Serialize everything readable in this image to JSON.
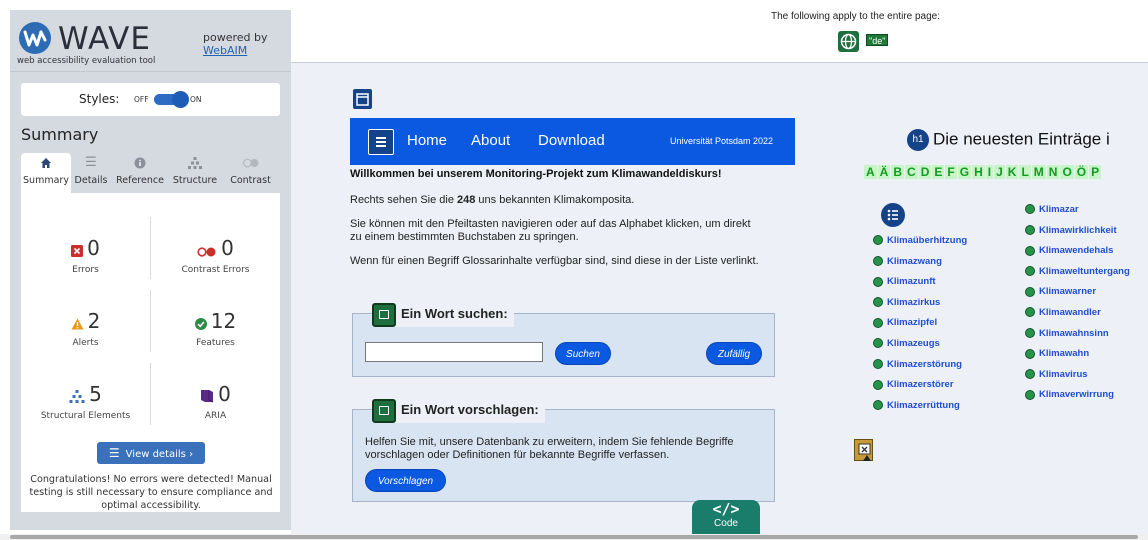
{
  "wave": {
    "logo_text": "WAVE",
    "tagline": "web accessibility evaluation tool",
    "powered_by": "powered by",
    "webaim_link": "WebAIM",
    "styles_label": "Styles:",
    "styles_off": "OFF",
    "styles_on": "ON",
    "summary_heading": "Summary",
    "tabs": [
      {
        "label": "Summary",
        "icon": "home-icon",
        "active": true
      },
      {
        "label": "Details",
        "icon": "list-icon",
        "active": false
      },
      {
        "label": "Reference",
        "icon": "info-icon",
        "active": false
      },
      {
        "label": "Structure",
        "icon": "hierarchy-icon",
        "active": false
      },
      {
        "label": "Contrast",
        "icon": "contrast-icon",
        "active": false
      }
    ],
    "stats": {
      "errors": {
        "value": "0",
        "label": "Errors"
      },
      "contrast_errors": {
        "value": "0",
        "label": "Contrast Errors"
      },
      "alerts": {
        "value": "2",
        "label": "Alerts"
      },
      "features": {
        "value": "12",
        "label": "Features"
      },
      "structural": {
        "value": "5",
        "label": "Structural Elements"
      },
      "aria": {
        "value": "0",
        "label": "ARIA"
      }
    },
    "view_details": "View details ›",
    "congrats": "Congratulations! No errors were detected! Manual testing is still necessary to ensure compliance and optimal accessibility."
  },
  "page_top": {
    "notice": "The following apply to the entire page:",
    "lang_badge": "\"de\""
  },
  "site": {
    "nav": {
      "home": "Home",
      "about": "About",
      "download": "Download",
      "university": "Universität Potsdam 2022"
    },
    "intro_title": "Willkommen bei unserem Monitoring-Projekt zum Klimawandeldiskurs!",
    "intro_p1_prefix": "Rechts sehen Sie die ",
    "intro_p1_count": "248",
    "intro_p1_suffix": " uns bekannten Klimakomposita.",
    "intro_p2": "Sie können mit den Pfeiltasten navigieren oder auf das Alphabet klicken, um direkt zu einem bestimmten Buchstaben zu springen.",
    "intro_p3": "Wenn für einen Begriff Glossarinhalte verfügbar sind, sind diese in der Liste verlinkt.",
    "search_legend": "Ein Wort suchen:",
    "search_value": "",
    "search_button": "Suchen",
    "random_button": "Zufällig",
    "suggest_legend": "Ein Wort vorschlagen:",
    "suggest_text": "Helfen Sie mit, unsere Datenbank zu erweitern, indem Sie fehlende Begriffe vorschlagen oder Definitionen für bekannte Begriffe verfassen.",
    "suggest_button": "Vorschlagen",
    "entries_heading": "Die neuesten Einträge i",
    "h1_badge": "h1",
    "alphabet": [
      "A",
      "Ä",
      "B",
      "C",
      "D",
      "E",
      "F",
      "G",
      "H",
      "I",
      "J",
      "K",
      "L",
      "M",
      "N",
      "O",
      "Ö",
      "P"
    ],
    "terms_left": [
      "Klimaüberhitzung",
      "Klimazwang",
      "Klimazunft",
      "Klimazirkus",
      "Klimazipfel",
      "Klimazeugs",
      "Klimazerstörung",
      "Klimazerstörer",
      "Klimazerrüttung"
    ],
    "terms_right": [
      "Klimazar",
      "Klimawirklichkeit",
      "Klimawendehals",
      "Klimaweltuntergang",
      "Klimawarner",
      "Klimawandler",
      "Klimawahnsinn",
      "Klimawahn",
      "Klimavirus",
      "Klimaverwirrung"
    ],
    "code_tab_symbol": "</>",
    "code_tab_label": "Code"
  }
}
